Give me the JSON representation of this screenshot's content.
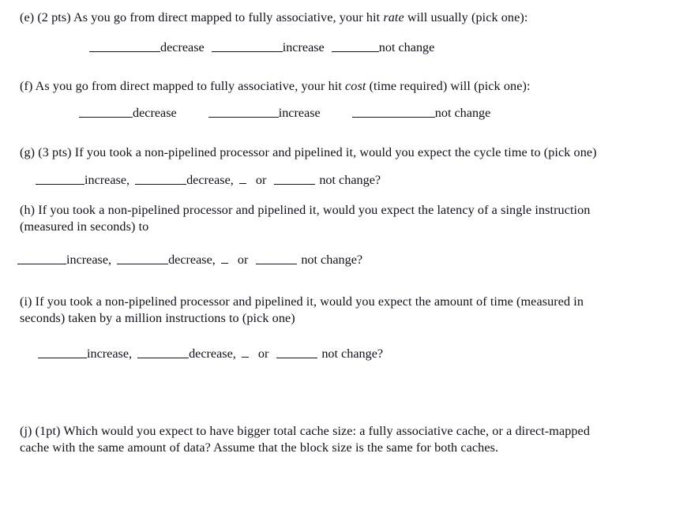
{
  "document": {
    "type": "exam-worksheet",
    "background_color": "#ffffff",
    "text_color": "#10101a"
  },
  "questions": [
    {
      "id": "e",
      "stem_before_italic": "(e) (2 pts) As you go from direct mapped to fully associative, your hit ",
      "italic_word": "rate",
      "stem_after_italic": " will usually (pick one):",
      "options": [
        "decrease",
        "increase",
        "not change"
      ]
    },
    {
      "id": "f",
      "stem_before_italic": "(f) As you go from direct mapped to fully associative, your hit ",
      "italic_word": "cost",
      "stem_after_italic": " (time required) will (pick one):",
      "options": [
        "decrease",
        "increase",
        "not change"
      ]
    },
    {
      "id": "g",
      "stem": "(g) (3 pts) If you took a non-pipelined processor and pipelined it, would you expect the cycle time to (pick one)",
      "options": [
        "increase,",
        "decrease,",
        "or",
        "not change?"
      ]
    },
    {
      "id": "h",
      "stem_line1": "(h) If you took a non-pipelined processor and pipelined it, would you expect the latency of a single instruction",
      "stem_line2": "(measured in seconds) to",
      "options": [
        "increase,",
        "decrease,",
        "or",
        "not change?"
      ]
    },
    {
      "id": "i",
      "stem_line1": "(i) If you took a non-pipelined processor and pipelined it, would you expect the amount of time (measured in",
      "stem_line2": "seconds) taken by a million instructions to (pick one)",
      "options": [
        "increase,",
        "decrease,",
        "or",
        "not change?"
      ]
    },
    {
      "id": "j",
      "stem_line1": "(j) (1pt) Which would you expect to have bigger total cache size: a fully associative cache, or a direct-mapped",
      "stem_line2": "cache with the same amount of data? Assume that the block size is the same for both caches."
    }
  ]
}
